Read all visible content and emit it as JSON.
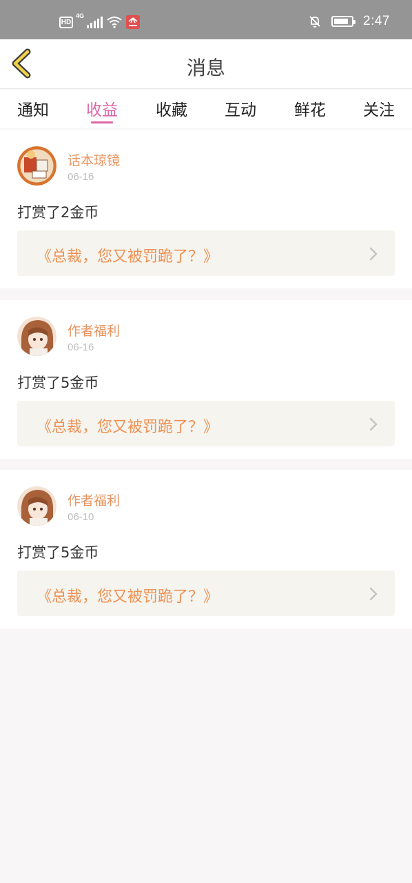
{
  "status_bar": {
    "hd_badge": "HD",
    "network": "4G",
    "time": "2:47",
    "icons": [
      "signal-icon",
      "wifi-icon",
      "huawei-app-icon",
      "bell-off-icon",
      "battery-icon"
    ]
  },
  "header": {
    "title": "消息"
  },
  "tabs": [
    {
      "label": "通知",
      "active": false
    },
    {
      "label": "收益",
      "active": true
    },
    {
      "label": "收藏",
      "active": false
    },
    {
      "label": "互动",
      "active": false
    },
    {
      "label": "鲜花",
      "active": false
    },
    {
      "label": "关注",
      "active": false
    }
  ],
  "messages": [
    {
      "name": "话本琼镜",
      "date": "06-16",
      "text": "打赏了2金币",
      "book": "《总裁，您又被罚跪了？》"
    },
    {
      "name": "作者福利",
      "date": "06-16",
      "text": "打赏了5金币",
      "book": "《总裁，您又被罚跪了？》"
    },
    {
      "name": "作者福利",
      "date": "06-10",
      "text": "打赏了5金币",
      "book": "《总裁，您又被罚跪了？》"
    }
  ],
  "colors": {
    "accent_pink": "#d966a6",
    "name_orange": "#e8945f",
    "book_orange": "#ee9155",
    "status_bar": "#959595",
    "back_arrow": "#f2d34a"
  }
}
